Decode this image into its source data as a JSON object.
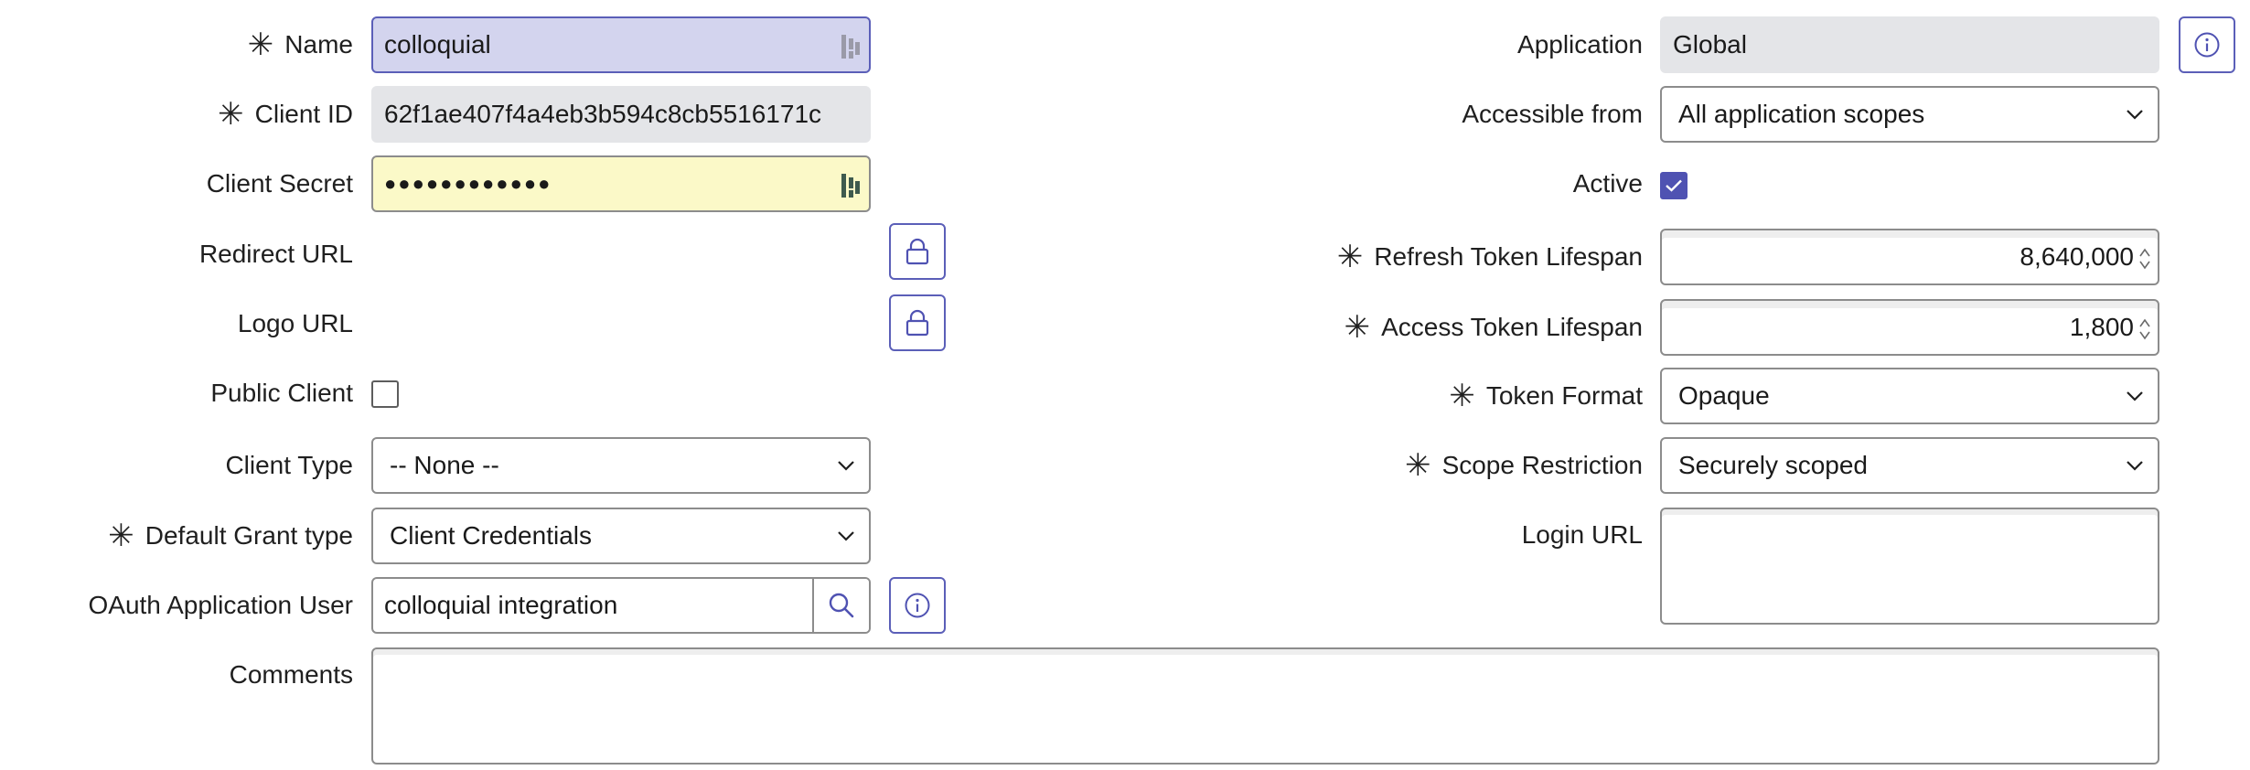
{
  "left": {
    "name": {
      "label": "Name",
      "value": "colloquial"
    },
    "client_id": {
      "label": "Client ID",
      "value": "62f1ae407f4a4eb3b594c8cb5516171c"
    },
    "client_secret": {
      "label": "Client Secret",
      "value": "●●●●●●●●●●●●"
    },
    "redirect_url": {
      "label": "Redirect URL"
    },
    "logo_url": {
      "label": "Logo URL"
    },
    "public_client": {
      "label": "Public Client",
      "checked": false
    },
    "client_type": {
      "label": "Client Type",
      "value": "-- None --"
    },
    "default_grant_type": {
      "label": "Default Grant type",
      "value": "Client Credentials"
    },
    "oauth_app_user": {
      "label": "OAuth Application User",
      "value": "colloquial integration"
    },
    "comments": {
      "label": "Comments",
      "value": ""
    }
  },
  "right": {
    "application": {
      "label": "Application",
      "value": "Global"
    },
    "accessible_from": {
      "label": "Accessible from",
      "value": "All application scopes"
    },
    "active": {
      "label": "Active",
      "checked": true
    },
    "refresh_token_lifespan": {
      "label": "Refresh Token Lifespan",
      "value": "8,640,000"
    },
    "access_token_lifespan": {
      "label": "Access Token Lifespan",
      "value": "1,800"
    },
    "token_format": {
      "label": "Token Format",
      "value": "Opaque"
    },
    "scope_restriction": {
      "label": "Scope Restriction",
      "value": "Securely scoped"
    },
    "login_url": {
      "label": "Login URL",
      "value": ""
    }
  },
  "required_mark": "✳",
  "colors": {
    "accent": "#4f52b2",
    "focus_bg": "#d3d4ee",
    "secret_bg": "#fbf9c8",
    "readonly_bg": "#e4e5e8"
  },
  "icons": [
    "lock-icon",
    "info-icon",
    "search-icon",
    "chevron-down-icon",
    "password-manager-icon",
    "checkmark-icon"
  ]
}
